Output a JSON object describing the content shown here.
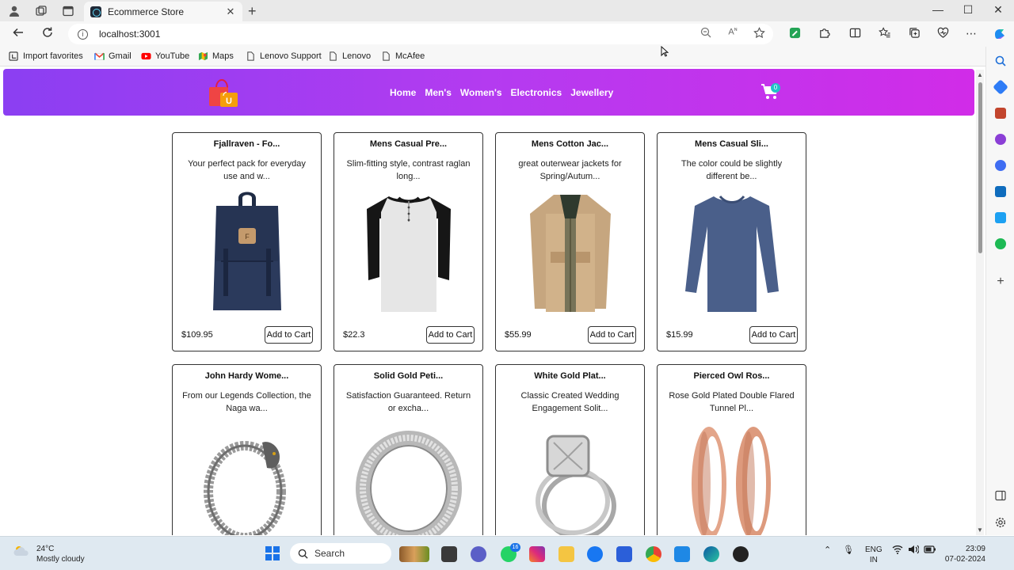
{
  "browser": {
    "tab_title": "Ecommerce Store",
    "tab_close": "✕",
    "new_tab": "+",
    "url": "localhost:3001",
    "window_controls": {
      "minimize": "—",
      "maximize": "☐",
      "close": "✕"
    },
    "bookmarks": [
      {
        "label": "Import favorites",
        "icon": "import-icon"
      },
      {
        "label": "Gmail",
        "icon": "gmail-icon"
      },
      {
        "label": "YouTube",
        "icon": "youtube-icon"
      },
      {
        "label": "Maps",
        "icon": "maps-icon"
      },
      {
        "label": "Lenovo Support",
        "icon": "page-icon"
      },
      {
        "label": "Lenovo",
        "icon": "page-icon"
      },
      {
        "label": "McAfee",
        "icon": "page-icon"
      }
    ]
  },
  "site": {
    "nav": [
      "Home",
      "Men's",
      "Women's",
      "Electronics",
      "Jewellery"
    ],
    "logo_letter": "U",
    "cart_count": "0",
    "brand_gradient": [
      "#8b3ff2",
      "#d12ce8"
    ]
  },
  "products": [
    {
      "title": "Fjallraven - Fo...",
      "desc": "Your perfect pack for everyday use and w...",
      "price": "$109.95",
      "button": "Add to Cart",
      "image": "backpack"
    },
    {
      "title": "Mens Casual Pre...",
      "desc": "Slim-fitting style, contrast raglan long...",
      "price": "$22.3",
      "button": "Add to Cart",
      "image": "raglan-tshirt"
    },
    {
      "title": "Mens Cotton Jac...",
      "desc": "great outerwear jackets for Spring/Autum...",
      "price": "$55.99",
      "button": "Add to Cart",
      "image": "jacket"
    },
    {
      "title": "Mens Casual Sli...",
      "desc": "The color could be slightly different be...",
      "price": "$15.99",
      "button": "Add to Cart",
      "image": "long-sleeve-shirt"
    },
    {
      "title": "John Hardy Wome...",
      "desc": "From our Legends Collection, the Naga wa...",
      "price": "",
      "button": "",
      "image": "bracelet"
    },
    {
      "title": "Solid Gold Peti...",
      "desc": "Satisfaction Guaranteed. Return or excha...",
      "price": "",
      "button": "",
      "image": "silver-ring"
    },
    {
      "title": "White Gold Plat...",
      "desc": "Classic Created Wedding Engagement Solit...",
      "price": "",
      "button": "",
      "image": "engagement-ring"
    },
    {
      "title": "Pierced Owl Ros...",
      "desc": "Rose Gold Plated Double Flared Tunnel Pl...",
      "price": "",
      "button": "",
      "image": "tunnel-plugs"
    }
  ],
  "taskbar": {
    "weather_temp": "24°C",
    "weather_desc": "Mostly cloudy",
    "search_label": "Search",
    "lang_1": "ENG",
    "lang_2": "IN",
    "time": "23:09",
    "date": "07-02-2024",
    "whatsapp_badge": "16"
  }
}
